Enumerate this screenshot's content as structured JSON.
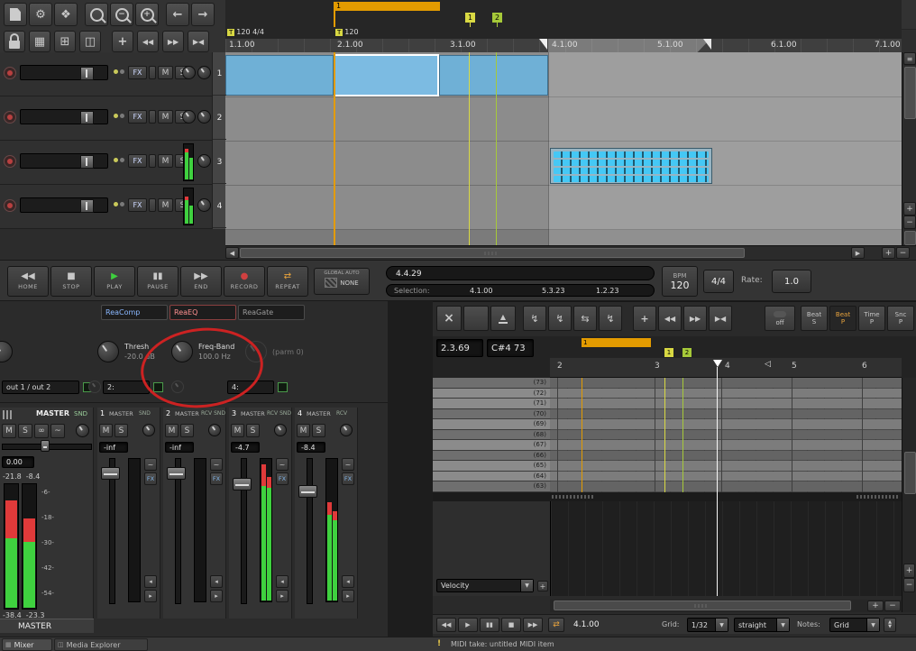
{
  "colors": {
    "accent_orange": "#e39b00",
    "marker_yellow": "#d9d943",
    "marker_green": "#a6c939",
    "item_blue": "#6fb0d6",
    "meter_green": "#3fd13f",
    "meter_red": "#e03a3a",
    "annotation_red": "#cc2222"
  },
  "icons": {
    "wrench": "⚙",
    "actions": "❖",
    "zoom_plus": "+",
    "zoom_minus": "−",
    "undo": "←",
    "redo": "→",
    "grid_large": "▦",
    "grid_small": "⊞",
    "docker": "◫",
    "snap": "+",
    "nav_start": "◀◀",
    "nav_end": "▶▶",
    "nav_fit": "▶◀",
    "menu": "≡",
    "plus": "+",
    "minus": "−",
    "scroll_left": "◀",
    "scroll_right": "▶",
    "dropdown": "▼",
    "eject": "▲",
    "tool_bolt": "↯",
    "tool_swap": "⇆",
    "close": "×",
    "phase": "∞",
    "env": "~",
    "recv": "◂",
    "send": "▸",
    "repeat": "⇄",
    "warn": "!",
    "hatch_none": "▨"
  },
  "ruler": {
    "tempo1_badge": "T",
    "tempo1_text": "120 4/4",
    "tempo2_badge": "T",
    "tempo2_text": "120",
    "labels": [
      "1.1.00",
      "2.1.00",
      "3.1.00",
      "4.1.00",
      "5.1.00",
      "6.1.00",
      "7.1.00"
    ]
  },
  "markers": {
    "region": "1",
    "m1": "1",
    "m2": "2"
  },
  "tcp": {
    "fx": "FX",
    "mute": "M",
    "solo": "S",
    "tracks": [
      {
        "num": "1"
      },
      {
        "num": "2"
      },
      {
        "num": "3"
      },
      {
        "num": "4"
      }
    ]
  },
  "transport": {
    "buttons": [
      {
        "icon": "◀◀",
        "label": "HOME"
      },
      {
        "icon": "■",
        "label": "STOP"
      },
      {
        "icon": "▶",
        "label": "PLAY"
      },
      {
        "icon": "▮▮",
        "label": "PAUSE"
      },
      {
        "icon": "▶▶",
        "label": "END"
      },
      {
        "icon": "●",
        "label": "RECORD"
      },
      {
        "icon": "⇄",
        "label": "REPEAT"
      }
    ],
    "global_auto_label": "GLOBAL AUTO",
    "global_auto_value": "NONE",
    "position": "4.4.29",
    "selection_label": "Selection:",
    "selection_start": "4.1.00",
    "selection_end": "5.3.23",
    "selection_length": "1.2.23",
    "bpm_label": "BPM",
    "bpm_value": "120",
    "time_signature": "4/4",
    "rate_label": "Rate:",
    "rate_value": "1.0"
  },
  "fx_panel": {
    "slots": [
      "ReaComp",
      "ReaEQ",
      "ReaGate"
    ],
    "knobs": [
      {
        "label": "Thresh",
        "value": "-20.0 dB"
      },
      {
        "label": "Freq-Band",
        "value": "100.0 Hz"
      },
      {
        "label": "(parm 0)",
        "value": ""
      }
    ]
  },
  "sends": {
    "send1": "out 1 / out 2",
    "send2": "2:",
    "send3": "4:"
  },
  "mixer": {
    "master": {
      "title": "MASTER",
      "tag": "SND",
      "m": "M",
      "s": "S",
      "value": "0.00",
      "peak_top": "-21.8  -8.4",
      "peak_bottom": "-38.4  -23.3",
      "scale": [
        "-6-",
        "-18-",
        "-30-",
        "-42-",
        "-54-"
      ],
      "bottom_label": "MASTER"
    },
    "strip_btn_m": "M",
    "strip_btn_s": "S",
    "strip_btn_fx": "FX",
    "strips": [
      {
        "num": "1",
        "route": "MASTER",
        "tag": "SND",
        "value": "-inf"
      },
      {
        "num": "2",
        "route": "MASTER",
        "tag": "RCV SND",
        "value": "-inf"
      },
      {
        "num": "3",
        "route": "MASTER",
        "tag": "RCV SND",
        "value": "-4.7"
      },
      {
        "num": "4",
        "route": "MASTER",
        "tag": "RCV",
        "value": "-8.4"
      }
    ]
  },
  "footer": {
    "tabs": [
      "Mixer",
      "Media Explorer"
    ],
    "status_icon": "!",
    "status_text": "MIDI take: untitled MIDI item"
  },
  "midi": {
    "position": "2.3.69",
    "note_readout": "C#4 73",
    "off_label": "off",
    "mode_buttons": [
      {
        "t": "Beat",
        "b": "S"
      },
      {
        "t": "Beat",
        "b": "P"
      },
      {
        "t": "Time",
        "b": "P"
      },
      {
        "t": "Snc",
        "b": "P"
      }
    ],
    "ruler_numbers": [
      "2",
      "3",
      "4",
      "5",
      "6"
    ],
    "region": "1",
    "m1": "1",
    "m2": "2",
    "rows": [
      "(73)",
      "(72)",
      "(71)",
      "(70)",
      "(69)",
      "(68)",
      "(67)",
      "(66)",
      "(65)",
      "(64)",
      "(63)"
    ],
    "velocity_label": "Velocity",
    "cursor_pos": "4.1.00",
    "grid_label": "Grid:",
    "grid_value": "1/32",
    "swing_value": "straight",
    "notes_label": "Notes:",
    "notes_value": "Grid"
  }
}
